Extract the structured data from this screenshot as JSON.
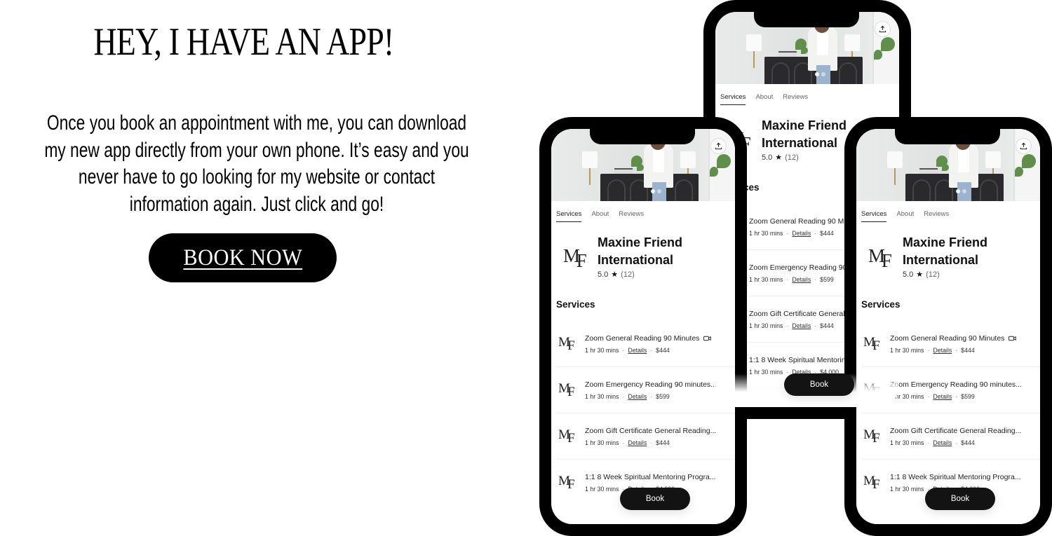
{
  "headline": "HEY, I HAVE AN APP!",
  "intro": "Once you book an appointment with me, you can download my new app directly from your own phone. It’s easy and you never have to go looking for my website or contact information again. Just click and go!",
  "cta": {
    "label": "BOOK NOW"
  },
  "app": {
    "share_icon": "share-upload-icon",
    "tabs": [
      {
        "label": "Services",
        "active": true
      },
      {
        "label": "About",
        "active": false
      },
      {
        "label": "Reviews",
        "active": false
      }
    ],
    "business": {
      "logo_m": "M",
      "logo_f": "F",
      "name": "Maxine Friend International",
      "rating": "5.0",
      "star_icon": "★",
      "review_count": "(12)"
    },
    "services_heading": "Services",
    "services": [
      {
        "title": "Zoom General Reading 90 Minutes",
        "duration": "1 hr 30 mins",
        "details_label": "Details",
        "price": "$444",
        "video_icon": true
      },
      {
        "title": "Zoom Emergency Reading 90 minutes...",
        "duration": "1 hr 30 mins",
        "details_label": "Details",
        "price": "$599",
        "video_icon": false
      },
      {
        "title": "Zoom Gift Certificate General Reading...",
        "duration": "1 hr 30 mins",
        "details_label": "Details",
        "price": "$444",
        "video_icon": false
      },
      {
        "title": "1:1 8 Week Spiritual Mentoring Progra...",
        "duration": "1 hr 30 mins",
        "details_label": "Details",
        "price": "$4,000",
        "video_icon": false
      }
    ],
    "separator": "·",
    "book_label": "Book"
  }
}
